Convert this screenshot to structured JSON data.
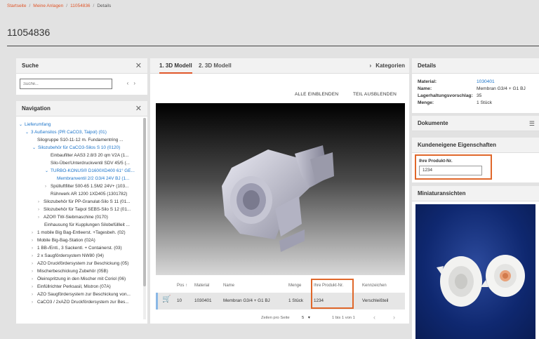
{
  "breadcrumb": {
    "home": "Startseite",
    "plants": "Meine Anlagen",
    "id": "11054836",
    "current": "Details"
  },
  "page_title": "11054836",
  "search": {
    "title": "Suche",
    "placeholder": "Suche..."
  },
  "navigation": {
    "title": "Navigation",
    "items": [
      "Lieferumfang",
      "3 Außensilos (PR CaCO3, Taipol) (01)",
      "Silogruppe S10-11-12 m. Fundamentring ...",
      "Silozubehör für CaCO3-Silos S 10 (0120)",
      "Einbaufilter AAS3 2.8/3 20 qm V2A (1...",
      "Silo-Über/Unterdruckventil SDV 45/5 (...",
      "TURBO-KONUS® D1600XD400 61° GE...",
      "Membranventil 2/2 G3/4 24V BJ (1...",
      "Spülluftfilter 500-65 1.5M2 24V+ (103...",
      "Rührwerk AR 1200 1XD405 (1301782)",
      "Silozubehör für PP-Granulat-Silo S 11 (01...",
      "Silozubehör für Taipol SEBS-Silo S 12 (01...",
      "AZO® TW-Siebmaschine (0170)",
      "Einhausung für Kupplungen Silobefüllleit ...",
      "1 mobile Big Bag-Entleerst. +Tagesbeh. (02)",
      "Mobile Big-Bag-Station (02A)",
      "1 BB-/Entl., 3 Sackentl. + Containerst. (03)",
      "2 x Saugfördersystem NW80 (04)",
      "AZO Druckfördersystem zur Beschickung (05)",
      "Mischerbeschickung Zubehör (05B)",
      "Öleinspritzung in den Mischer mit Coriol (06)",
      "Einfüllrichter Perksasil, Mistron (07A)",
      "AZO Saugfördersystem zur Beschickung von...",
      "CaCO3 / 2xAZO Druckfördersystem zur Bes..."
    ]
  },
  "model": {
    "tab1": "1. 3D Modell",
    "tab2": "2. 3D Modell",
    "categories": "Kategorien",
    "show_all": "ALLE EINBLENDEN",
    "hide_part": "TEIL AUSBLENDEN"
  },
  "table": {
    "headers": {
      "pos": "Pos",
      "material": "Material",
      "name": "Name",
      "qty": "Menge",
      "product_no": "Ihre Produkt-Nr.",
      "tag": "Kennzeichen"
    },
    "row": {
      "pos": "10",
      "material": "1030401",
      "name": "Membran G3/4 + G1 BJ",
      "qty": "1 Stück",
      "product_no": "1234",
      "tag": "Verschleißteil"
    }
  },
  "pager": {
    "label": "Zeilen pro Seite",
    "size": "5",
    "range": "1 bis 1 von 1"
  },
  "details": {
    "title": "Details",
    "material_label": "Material:",
    "material": "1030401",
    "name_label": "Name:",
    "name": "Membran G3/4 + G1 BJ",
    "stock_label": "Lagerhaltungsvorschlag:",
    "stock": "35",
    "qty_label": "Menge:",
    "qty": "1 Stück"
  },
  "documents": {
    "title": "Dokumente"
  },
  "custom_props": {
    "title": "Kundeneigene Eigenschaften",
    "label": "Ihre Produkt-Nr.",
    "value": "1234"
  },
  "thumbnails": {
    "title": "Miniaturansichten"
  },
  "colors": {
    "accent": "#e0572a",
    "link": "#1a73c9",
    "highlight_box": "#e0672a"
  }
}
